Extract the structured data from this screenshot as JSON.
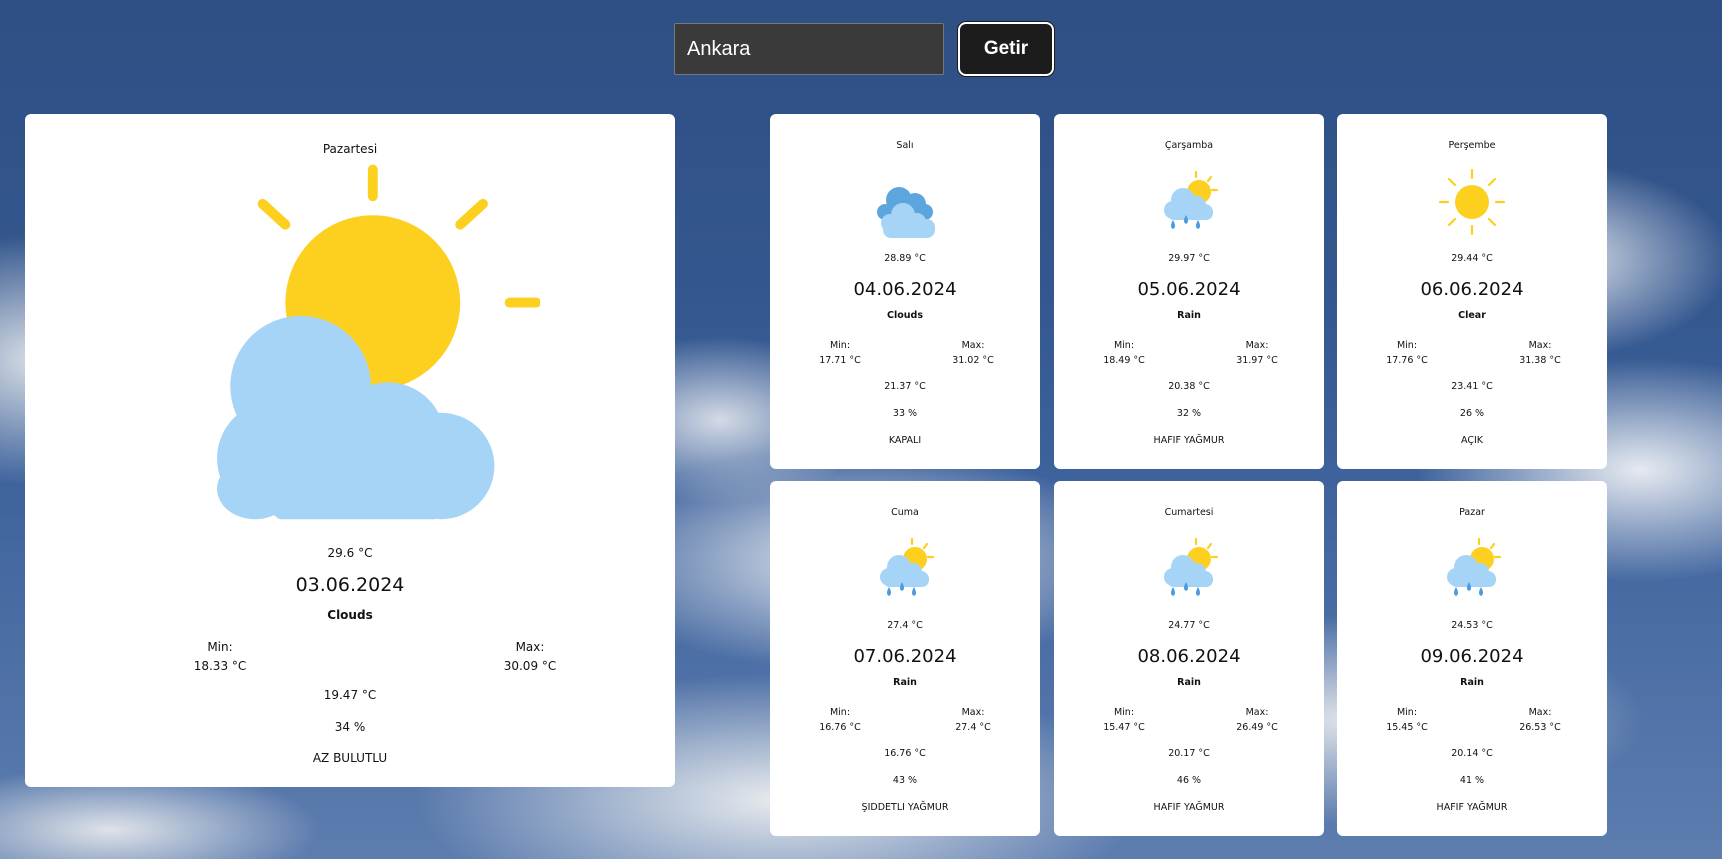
{
  "search": {
    "value": "Ankara",
    "button_label": "Getir"
  },
  "today": {
    "day": "Pazartesi",
    "icon": "partly-cloudy-icon",
    "temp": "29.6 °C",
    "date": "03.06.2024",
    "main": "Clouds",
    "min_label": "Min:",
    "min_value": "18.33 °C",
    "max_label": "Max:",
    "max_value": "30.09 °C",
    "feels": "19.47 °C",
    "humidity": "34 %",
    "description": "AZ BULUTLU"
  },
  "forecast": [
    {
      "day": "Salı",
      "icon": "cloudy-icon",
      "temp": "28.89 °C",
      "date": "04.06.2024",
      "main": "Clouds",
      "min_label": "Min:",
      "min_value": "17.71 °C",
      "max_label": "Max:",
      "max_value": "31.02 °C",
      "feels": "21.37 °C",
      "humidity": "33 %",
      "description": "KAPALI"
    },
    {
      "day": "Çarşamba",
      "icon": "sun-rain-icon",
      "temp": "29.97 °C",
      "date": "05.06.2024",
      "main": "Rain",
      "min_label": "Min:",
      "min_value": "18.49 °C",
      "max_label": "Max:",
      "max_value": "31.97 °C",
      "feels": "20.38 °C",
      "humidity": "32 %",
      "description": "HAFIF YAĞMUR"
    },
    {
      "day": "Perşembe",
      "icon": "sun-icon",
      "temp": "29.44 °C",
      "date": "06.06.2024",
      "main": "Clear",
      "min_label": "Min:",
      "min_value": "17.76 °C",
      "max_label": "Max:",
      "max_value": "31.38 °C",
      "feels": "23.41 °C",
      "humidity": "26 %",
      "description": "AÇIK"
    },
    {
      "day": "Cuma",
      "icon": "sun-rain-icon",
      "temp": "27.4 °C",
      "date": "07.06.2024",
      "main": "Rain",
      "min_label": "Min:",
      "min_value": "16.76 °C",
      "max_label": "Max:",
      "max_value": "27.4 °C",
      "feels": "16.76 °C",
      "humidity": "43 %",
      "description": "ŞIDDETLI YAĞMUR"
    },
    {
      "day": "Cumartesi",
      "icon": "sun-rain-icon",
      "temp": "24.77 °C",
      "date": "08.06.2024",
      "main": "Rain",
      "min_label": "Min:",
      "min_value": "15.47 °C",
      "max_label": "Max:",
      "max_value": "26.49 °C",
      "feels": "20.17 °C",
      "humidity": "46 %",
      "description": "HAFIF YAĞMUR"
    },
    {
      "day": "Pazar",
      "icon": "sun-rain-icon",
      "temp": "24.53 °C",
      "date": "09.06.2024",
      "main": "Rain",
      "min_label": "Min:",
      "min_value": "15.45 °C",
      "max_label": "Max:",
      "max_value": "26.53 °C",
      "feels": "20.14 °C",
      "humidity": "41 %",
      "description": "HAFIF YAĞMUR"
    }
  ],
  "colors": {
    "sun": "#fdd01f",
    "cloud": "#a6d4f7",
    "cloud_dark": "#5da6dd",
    "rain": "#4a9be0"
  }
}
